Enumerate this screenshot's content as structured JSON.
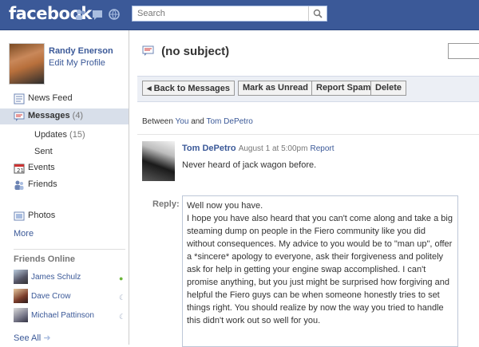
{
  "header": {
    "logo": "facebook",
    "search_placeholder": "Search"
  },
  "profile": {
    "name": "Randy Enerson",
    "edit_link": "Edit My Profile"
  },
  "nav": {
    "news_feed": "News Feed",
    "messages": "Messages",
    "messages_count": "(4)",
    "updates": "Updates",
    "updates_count": "(15)",
    "sent": "Sent",
    "events": "Events",
    "friends": "Friends",
    "photos": "Photos",
    "more": "More"
  },
  "friends_online": {
    "title": "Friends Online",
    "people": [
      {
        "name": "James Schulz",
        "status": "online",
        "status_color": "#6bb53a"
      },
      {
        "name": "Dave Crow",
        "status": "idle",
        "status_color": "#9aa7c0"
      },
      {
        "name": "Michael Pattinson",
        "status": "idle",
        "status_color": "#9aa7c0"
      }
    ],
    "see_all": "See All"
  },
  "thread": {
    "subject": "(no subject)",
    "buttons": {
      "back": "◂ Back to Messages",
      "mark_unread": "Mark as Unread",
      "report_spam": "Report Spam",
      "delete": "Delete"
    },
    "between_prefix": "Between",
    "between_you": "You",
    "between_and": "and",
    "between_other": "Tom DePetro",
    "message": {
      "author": "Tom DePetro",
      "date": "August 1 at 5:00pm",
      "report": "Report",
      "body": "Never heard of jack wagon before."
    },
    "reply_label": "Reply:",
    "reply_text": "Well now you have.\nI hope you have also heard that you can't come along and take a big steaming dump on people in the Fiero community like you did without consequences. My advice to you would be to \"man up\", offer a *sincere* apology to everyone, ask their forgiveness and politely ask for help in getting your engine swap accomplished. I can't promise anything, but you just might be surprised how forgiving and helpful the Fiero guys can be when someone honestly tries to set things right. You should realize by now the way you tried to handle this didn't work out so well for you."
  },
  "colors": {
    "brand_blue": "#3b5998",
    "selected_nav": "#d8dfea",
    "toolbar_bg": "#eceff5"
  }
}
